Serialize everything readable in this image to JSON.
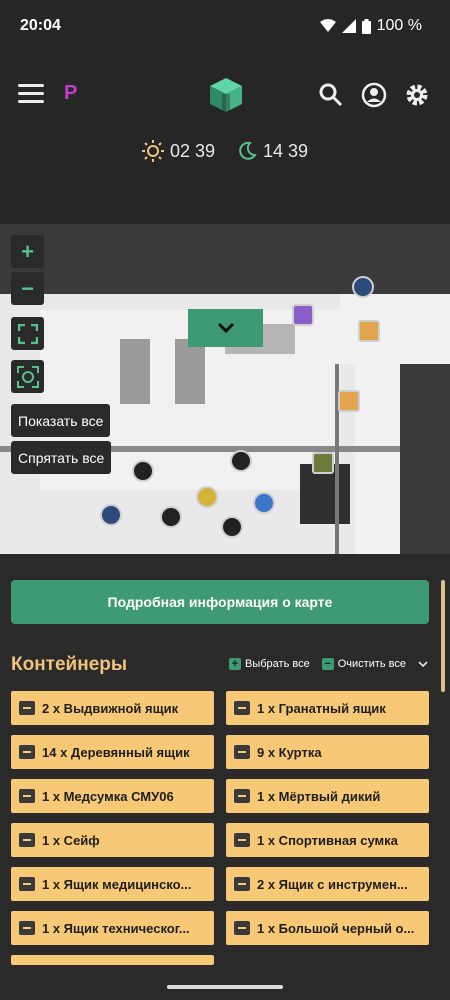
{
  "status": {
    "time": "20:04",
    "battery": "100 %"
  },
  "header": {
    "badge": "P"
  },
  "day_night": {
    "day": "02 39",
    "night": "14 39"
  },
  "map": {
    "zoom_in": "+",
    "zoom_out": "−",
    "show_all": "Показать все",
    "hide_all": "Спрятать все"
  },
  "panel": {
    "info_button": "Подробная информация о карте",
    "section_title": "Контейнеры",
    "select_all": "Выбрать все",
    "clear_all": "Очистить все",
    "items": [
      "2 x Выдвижной ящик",
      "1 x Гранатный ящик",
      "14 x Деревянный ящик",
      "9 x Куртка",
      "1 x Медсумка СМУ06",
      "1 x Мёртвый дикий",
      "1 x Сейф",
      "1 x Спортивная сумка",
      "1 x Ящик медицинско...",
      "2 x Ящик с инструмен...",
      "1 x Ящик техническог...",
      "1 x Большой черный о..."
    ]
  },
  "colors": {
    "accent": "#3e9a72",
    "item_bg": "#f7c876",
    "title": "#f0c27c",
    "badge": "#c23ccf"
  }
}
